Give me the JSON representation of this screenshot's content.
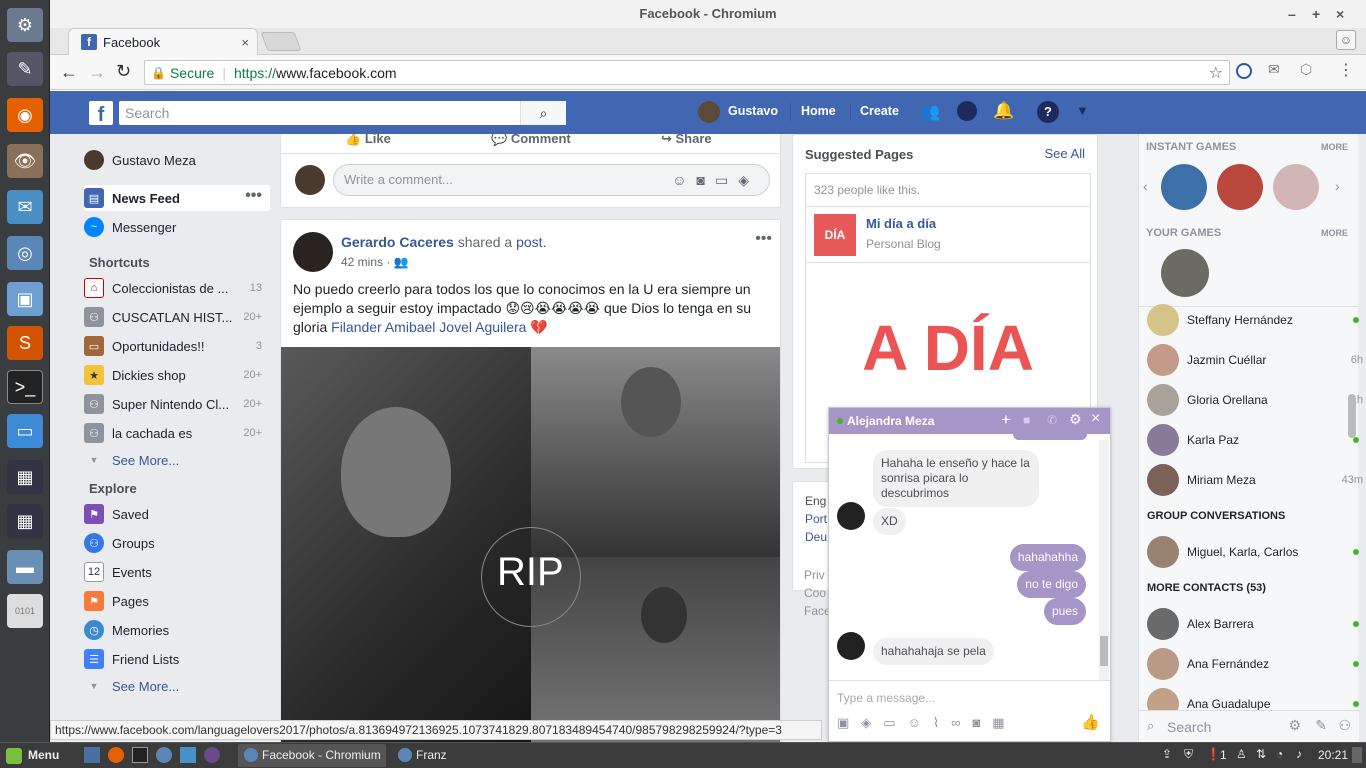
{
  "window": {
    "title": "Facebook - Chromium",
    "tab_title": "Facebook",
    "controls": [
      "–",
      "+",
      "×"
    ]
  },
  "address_bar": {
    "secure_label": "Secure",
    "url_scheme": "https://",
    "url_host": "www.facebook.com"
  },
  "fb_header": {
    "search_placeholder": "Search",
    "user_name": "Gustavo",
    "home": "Home",
    "create": "Create"
  },
  "left_nav": {
    "profile": "Gustavo Meza",
    "news_feed": "News Feed",
    "messenger": "Messenger",
    "shortcuts_title": "Shortcuts",
    "shortcuts": [
      {
        "label": "Coleccionistas de ...",
        "count": "13"
      },
      {
        "label": "CUSCATLAN HIST...",
        "count": "20+"
      },
      {
        "label": "Oportunidades!!",
        "count": "3"
      },
      {
        "label": "Dickies shop",
        "count": "20+"
      },
      {
        "label": "Super Nintendo Cl...",
        "count": "20+"
      },
      {
        "label": "la cachada es",
        "count": "20+"
      }
    ],
    "see_more": "See More...",
    "explore_title": "Explore",
    "explore": [
      "Saved",
      "Groups",
      "Events",
      "Pages",
      "Memories",
      "Friend Lists"
    ],
    "see_more_2": "See More..."
  },
  "feed": {
    "actions": {
      "like": "Like",
      "comment": "Comment",
      "share": "Share"
    },
    "comment_placeholder": "Write a comment...",
    "post": {
      "author": "Gerardo Caceres",
      "shared": "shared a",
      "post_link": "post.",
      "time": "42 mins ·",
      "text": "No puedo creerlo para todos los que lo conocimos en la U era siempre un ejemplo a seguir estoy impactado 😟😢😭😭😭😭 que Dios lo tenga en su gloria",
      "tag": "Filander Amibael Jovel Aguilera",
      "tag_emoji": "💔",
      "image_text": "RIP"
    }
  },
  "suggested": {
    "title": "Suggested Pages",
    "see_all": "See All",
    "likes": "323 people like this.",
    "page_name": "Mi día a día",
    "page_type": "Personal Blog",
    "logo_small": "DÍA",
    "banner": "A DÍA"
  },
  "footer_links": [
    "Eng",
    "Port",
    "Deu",
    "Priv",
    "Coo",
    "Face"
  ],
  "chat_window": {
    "name": "Alejandra Meza",
    "messages_in_1": "Hahaha le enseño y hace la sonrisa picara lo descubrimos",
    "messages_in_2": "XD",
    "messages_out": [
      "hahahahha",
      "no te digo",
      "pues"
    ],
    "messages_in_3": "hahahahaja se pela",
    "input_placeholder": "Type a message..."
  },
  "sidebar": {
    "instant_games": "INSTANT GAMES",
    "more": "MORE",
    "your_games": "YOUR GAMES",
    "more_2": "MORE",
    "contacts": [
      {
        "name": "Steffany Hernández",
        "status": ""
      },
      {
        "name": "Jazmin Cuéllar",
        "status": "6h"
      },
      {
        "name": "Gloria Orellana",
        "status": "1h"
      },
      {
        "name": "Karla Paz",
        "status": ""
      },
      {
        "name": "Miriam Meza",
        "status": "43m"
      }
    ],
    "group_title": "GROUP CONVERSATIONS",
    "group": "Miguel, Karla, Carlos",
    "more_contacts": "MORE CONTACTS (53)",
    "more_list": [
      "Alex Barrera",
      "Ana Fernández",
      "Ana Guadalupe"
    ],
    "search": "Search"
  },
  "status_url": "https://www.facebook.com/languagelovers2017/photos/a.813694972136925.1073741829.807183489454740/985798298259924/?type=3",
  "taskbar": {
    "menu": "Menu",
    "task1": "Facebook - Chromium",
    "task2": "Franz",
    "clock": "20:21",
    "tray_count": "1"
  }
}
